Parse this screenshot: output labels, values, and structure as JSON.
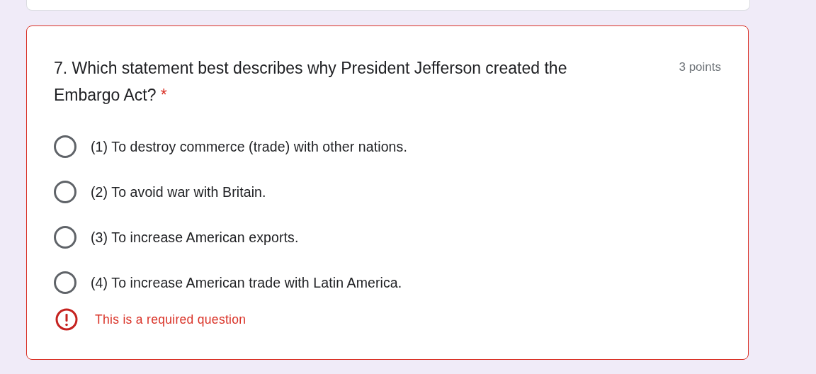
{
  "question": {
    "title": "7. Which statement best describes why President Jefferson created the Embargo Act?",
    "required_mark": "*",
    "points": "3 points",
    "error": true,
    "options": [
      {
        "label": "(1) To destroy commerce (trade) with other nations.",
        "selected": false
      },
      {
        "label": "(2) To avoid war with Britain.",
        "selected": false
      },
      {
        "label": "(3) To increase American exports.",
        "selected": false
      },
      {
        "label": "(4) To increase American trade with Latin America.",
        "selected": false
      }
    ],
    "error_message": "This is a required question"
  }
}
